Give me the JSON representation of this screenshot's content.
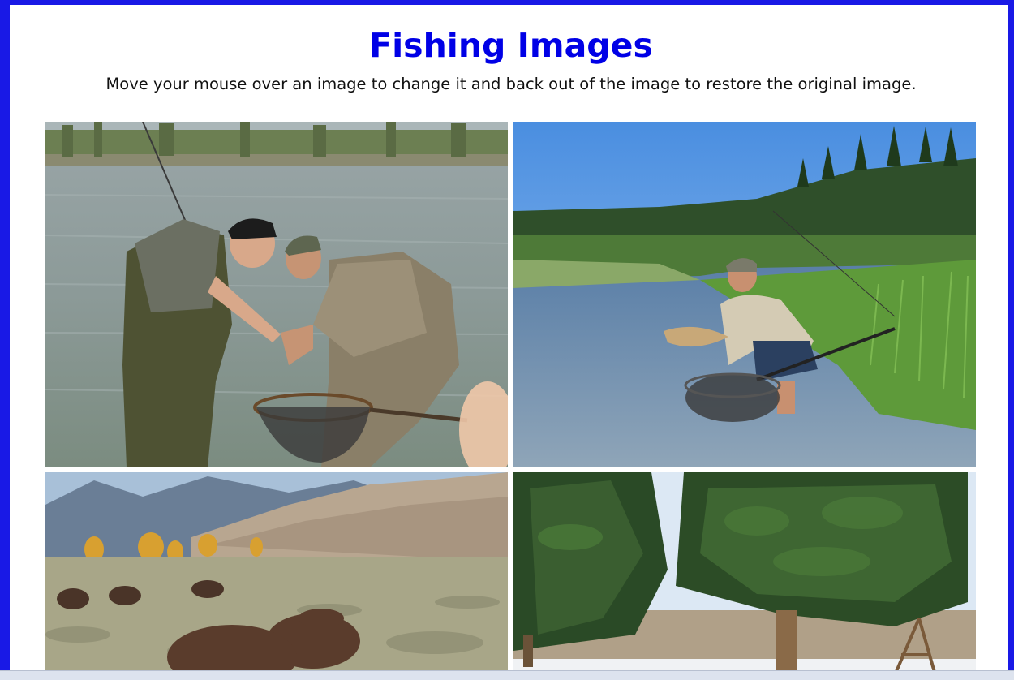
{
  "page": {
    "title": "Fishing Images",
    "instructions": "Move your mouse over an image to change it and back out of the image to restore the original image.",
    "title_color": "#0000e6",
    "frame_color": "#1919e6"
  },
  "images": [
    {
      "subject": "two anglers releasing a trout into a landing net in a river"
    },
    {
      "subject": "angler wading a stream holding a trout and a landing net"
    },
    {
      "subject": "bison grazing in a sagebrush meadow below mountains"
    },
    {
      "subject": "evergreen trees beside a snowy meadow"
    }
  ]
}
